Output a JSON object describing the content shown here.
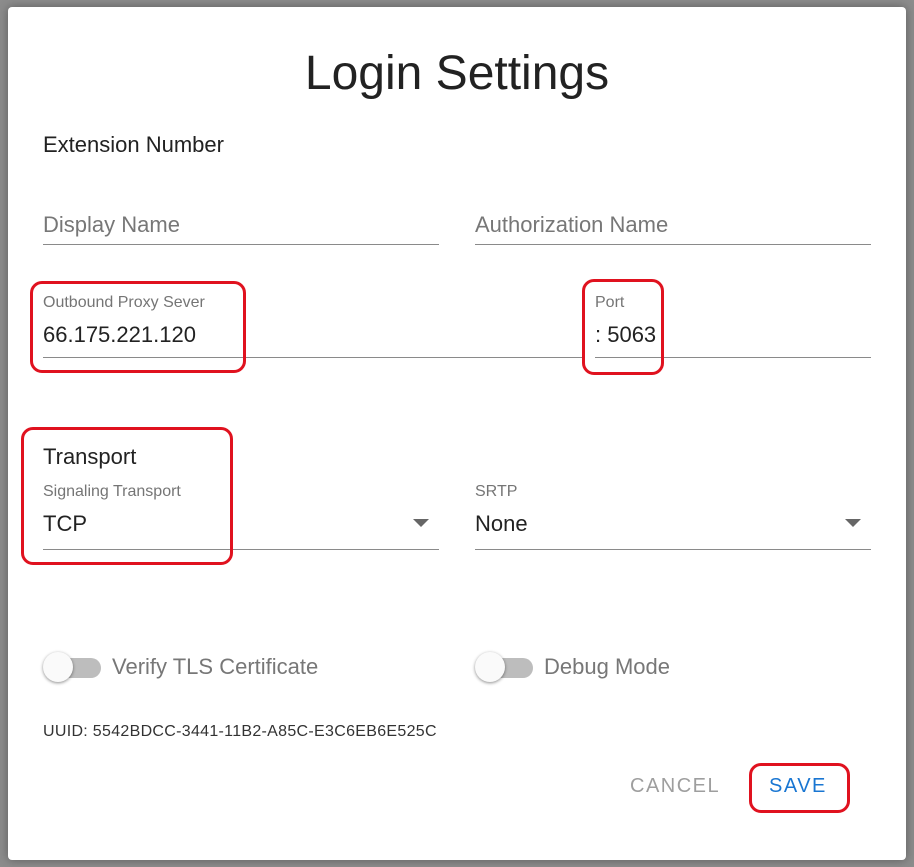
{
  "dialog": {
    "title": "Login Settings"
  },
  "extension": {
    "label": "Extension Number"
  },
  "display_name": {
    "placeholder": "Display Name",
    "value": ""
  },
  "authorization_name": {
    "placeholder": "Authorization Name",
    "value": ""
  },
  "outbound_proxy": {
    "label": "Outbound Proxy Sever",
    "value": "66.175.221.120"
  },
  "port": {
    "label": "Port",
    "value": ": 5063"
  },
  "transport": {
    "heading": "Transport",
    "signaling": {
      "label": "Signaling Transport",
      "selected": "TCP"
    },
    "srtp": {
      "label": "SRTP",
      "selected": "None"
    }
  },
  "toggles": {
    "verify_tls": {
      "label": "Verify TLS Certificate",
      "on": false
    },
    "debug_mode": {
      "label": "Debug Mode",
      "on": false
    }
  },
  "uuid": {
    "text": "UUID: 5542BDCC-3441-11B2-A85C-E3C6EB6E525C"
  },
  "actions": {
    "cancel_label": "CANCEL",
    "save_label": "SAVE"
  },
  "colors": {
    "accent": "#1976d2",
    "cancel": "#9e9e9e",
    "highlight": "#e0121f"
  },
  "icons": {
    "dropdown": "arrow-drop-down-icon"
  }
}
